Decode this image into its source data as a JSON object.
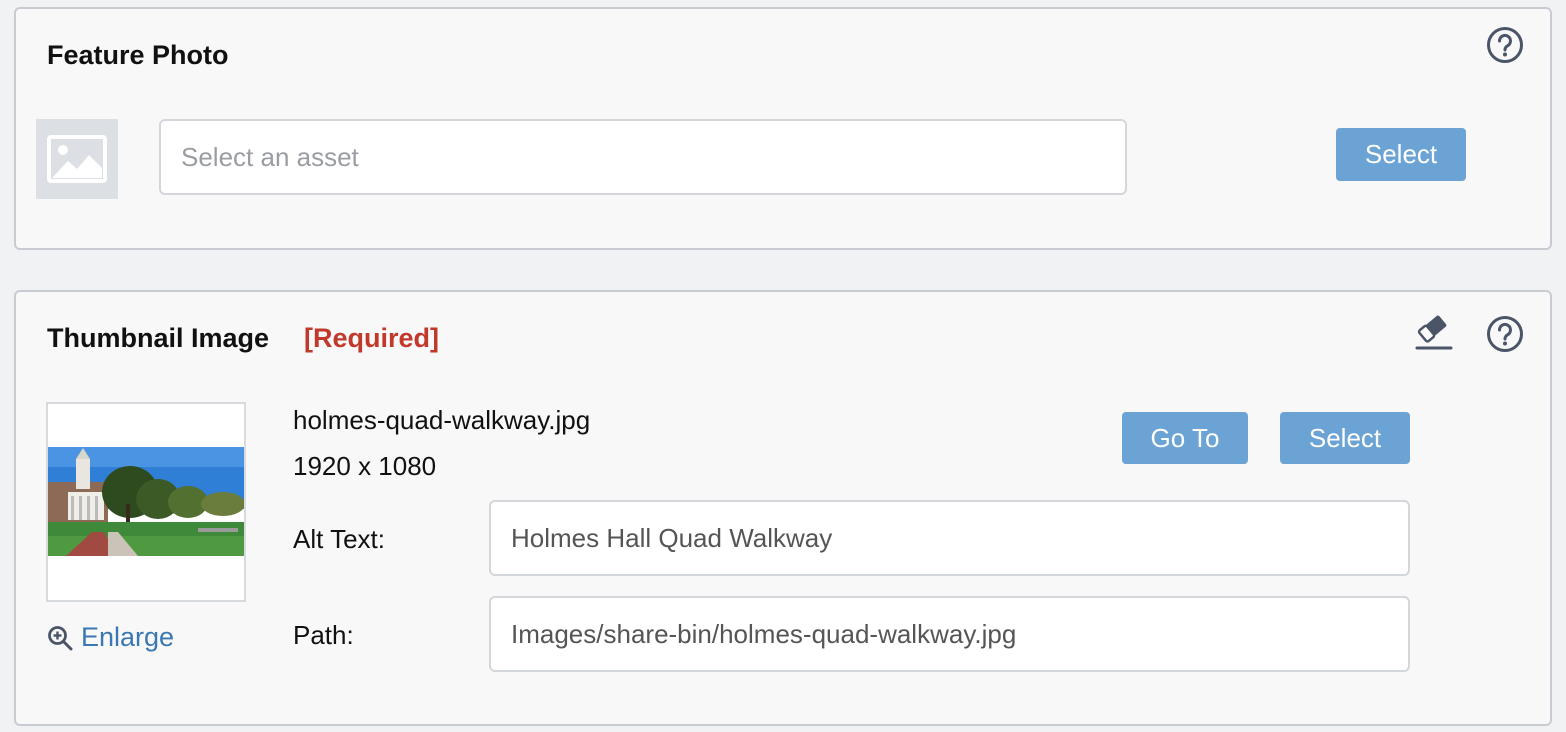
{
  "feature_photo": {
    "title": "Feature Photo",
    "asset_placeholder": "Select an asset",
    "select_label": "Select",
    "help_icon": "help-circle-icon",
    "image_icon": "image-placeholder-icon"
  },
  "thumbnail_image": {
    "title": "Thumbnail Image",
    "required_label": "[Required]",
    "clear_icon": "eraser-icon",
    "help_icon": "help-circle-icon",
    "file_name": "holmes-quad-walkway.jpg",
    "dimensions": "1920 x 1080",
    "goto_label": "Go To",
    "select_label": "Select",
    "alt_text_label": "Alt Text:",
    "alt_text_value": "Holmes Hall Quad Walkway",
    "path_label": "Path:",
    "path_value": "Images/share-bin/holmes-quad-walkway.jpg",
    "enlarge_label": "Enlarge",
    "enlarge_icon": "zoom-in-icon"
  },
  "colors": {
    "button": "#6aa3d4",
    "required": "#c0392b",
    "link": "#3a77b3",
    "panel_border": "#c8ccd2"
  }
}
